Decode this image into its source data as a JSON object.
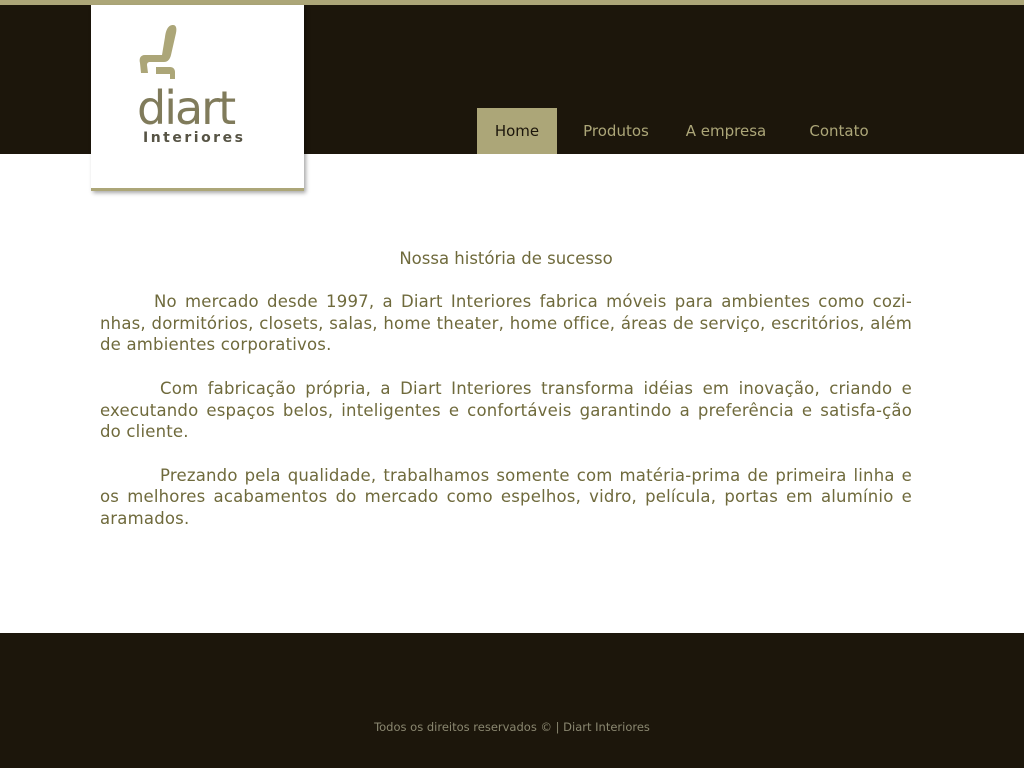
{
  "brand": {
    "name": "diart",
    "subtitle": "Interiores",
    "accent_color": "#aca678",
    "dark_color": "#1c160b",
    "text_color": "#6f6a3c"
  },
  "nav": {
    "items": [
      {
        "label": "Home",
        "active": true
      },
      {
        "label": "Produtos",
        "active": false
      },
      {
        "label": "A empresa",
        "active": false
      },
      {
        "label": "Contato",
        "active": false
      }
    ]
  },
  "content": {
    "title": "Nossa história de sucesso",
    "paragraphs": [
      "No mercado desde 1997, a Diart Interiores fabrica móveis para ambientes como cozi-nhas, dormitórios, closets, salas, home theater, home office, áreas de serviço, escritórios, além de ambientes corporativos.",
      "Com fabricação própria, a Diart Interiores transforma idéias em inovação, criando e executando espaços belos, inteligentes e confortáveis garantindo a preferência e satisfa-ção do cliente.",
      "Prezando pela qualidade, trabalhamos somente com matéria-prima de primeira linha e os melhores acabamentos do mercado como espelhos, vidro, película, portas em alumínio e aramados."
    ]
  },
  "footer": {
    "text": "Todos os direitos reservados © | Diart Interiores"
  }
}
